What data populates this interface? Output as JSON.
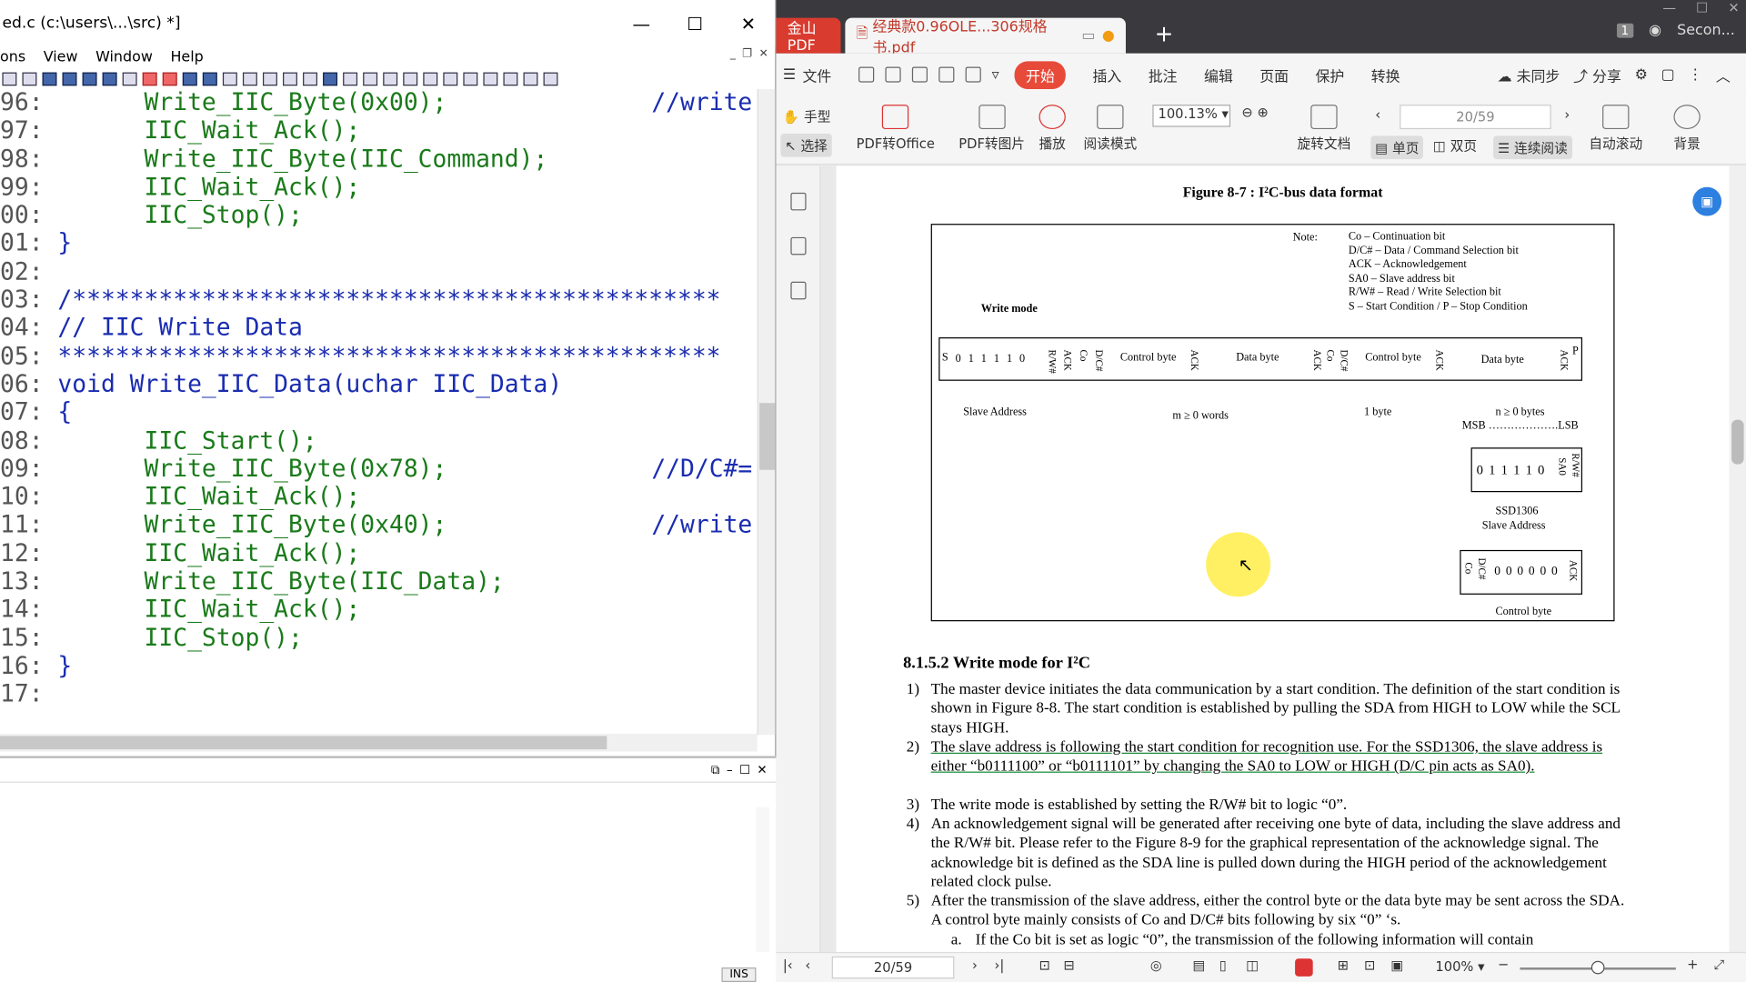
{
  "editor": {
    "title": "ed.c (c:\\users\\...\\src) *]",
    "menu": [
      "ons",
      "View",
      "Window",
      "Help"
    ],
    "code_lines": [
      {
        "num": "96:",
        "text": "      Write_IIC_Byte(0x00);",
        "comment": "//write",
        "cls": "fn"
      },
      {
        "num": "97:",
        "text": "      IIC_Wait_Ack();",
        "comment": "",
        "cls": "fn"
      },
      {
        "num": "98:",
        "text": "      Write_IIC_Byte(IIC_Command);",
        "comment": "",
        "cls": "fn"
      },
      {
        "num": "99:",
        "text": "      IIC_Wait_Ack();",
        "comment": "",
        "cls": "fn"
      },
      {
        "num": "00:",
        "text": "      IIC_Stop();",
        "comment": "",
        "cls": "fn"
      },
      {
        "num": "01:",
        "text": "}",
        "comment": "",
        "cls": "tx"
      },
      {
        "num": "02:",
        "text": "",
        "comment": "",
        "cls": "tx"
      },
      {
        "num": "03:",
        "text": "/*********************************************",
        "comment": "",
        "cls": "cm"
      },
      {
        "num": "04:",
        "text": "// IIC Write Data",
        "comment": "",
        "cls": "cm"
      },
      {
        "num": "05:",
        "text": "**********************************************",
        "comment": "",
        "cls": "cm"
      },
      {
        "num": "06:",
        "text": "void Write_IIC_Data(uchar IIC_Data)",
        "comment": "",
        "cls": "kw"
      },
      {
        "num": "07:",
        "text": "{",
        "comment": "",
        "cls": "tx"
      },
      {
        "num": "08:",
        "text": "      IIC_Start();",
        "comment": "",
        "cls": "fn"
      },
      {
        "num": "09:",
        "text": "      Write_IIC_Byte(0x78);",
        "comment": "//D/C#=",
        "cls": "fn"
      },
      {
        "num": "10:",
        "text": "      IIC_Wait_Ack();",
        "comment": "",
        "cls": "fn"
      },
      {
        "num": "11:",
        "text": "      Write_IIC_Byte(0x40);",
        "comment": "//write",
        "cls": "fn"
      },
      {
        "num": "12:",
        "text": "      IIC_Wait_Ack();",
        "comment": "",
        "cls": "fn"
      },
      {
        "num": "13:",
        "text": "      Write_IIC_Byte(IIC_Data);",
        "comment": "",
        "cls": "fn"
      },
      {
        "num": "14:",
        "text": "      IIC_Wait_Ack();",
        "comment": "",
        "cls": "fn"
      },
      {
        "num": "15:",
        "text": "      IIC_Stop();",
        "comment": "",
        "cls": "fn"
      },
      {
        "num": "16:",
        "text": "}",
        "comment": "",
        "cls": "tx"
      },
      {
        "num": "17:",
        "text": "",
        "comment": "",
        "cls": "tx"
      }
    ],
    "status_ins": "INS"
  },
  "pdf": {
    "tab_app": "金山PDF",
    "tab_doc": "经典款0.96OLE...306规格书.pdf",
    "account": "Secon...",
    "badge": "1",
    "menu": {
      "file": "文件",
      "start": "开始",
      "items": [
        "插入",
        "批注",
        "编辑",
        "页面",
        "保护",
        "转换"
      ],
      "sync": "未同步",
      "share": "分享"
    },
    "ribbon": {
      "hand": "手型",
      "select": "选择",
      "to_office": "PDF转Office",
      "to_image": "PDF转图片",
      "play": "播放",
      "read_mode": "阅读模式",
      "zoom": "100.13%",
      "rotate": "旋转文档",
      "page": "20/59",
      "single": "单页",
      "double": "双页",
      "continuous": "连续阅读",
      "autoscroll": "自动滚动",
      "background": "背景"
    },
    "status": {
      "page": "20/59",
      "zoom": "100%"
    },
    "figure": {
      "title": "Figure 8-7 : I²C-bus data format",
      "note_label": "Note:",
      "notes": [
        "Co – Continuation bit",
        "D/C# – Data / Command Selection bit",
        "ACK – Acknowledgement",
        "SA0 – Slave address bit",
        "R/W# – Read / Write Selection bit",
        "S – Start Condition / P – Stop Condition"
      ],
      "write_mode": "Write mode",
      "s": "S",
      "addr_bits": "0 1 1 1 1 0",
      "rw": "R/W#",
      "ack": "ACK",
      "co": "Co",
      "dc": "D/C#",
      "control_byte": "Control byte",
      "data_byte": "Data byte",
      "p": "P",
      "slave_address": "Slave Address",
      "m_words": "m ≥ 0 words",
      "one_byte": "1 byte",
      "n_bytes": "n ≥ 0 bytes",
      "msb_lsb": "MSB ……………….LSB",
      "ssd_bits": "0 1 1 1 1 0",
      "sa0": "SA0",
      "ssd_label": "SSD1306",
      "ssd_slave": "Slave Address",
      "ctrl_bits": "0 0 0 0 0 0",
      "ctrl_label": "Control byte"
    },
    "section": "8.1.5.2   Write mode for I²C",
    "paras": [
      {
        "n": "1)",
        "text": "The master device initiates the data communication by a start condition. The definition of the start condition is shown in Figure 8-8. The start condition is established by pulling the SDA from HIGH to LOW while the SCL stays HIGH."
      },
      {
        "n": "2)",
        "text": "The slave address is following the start condition for recognition use. For the SSD1306, the slave address is either “b0111100” or “b0111101” by changing the SA0 to LOW or HIGH (D/C pin acts as SA0)."
      },
      {
        "n": "3)",
        "text": "The write mode is established by setting the R/W# bit to logic “0”."
      },
      {
        "n": "4)",
        "text": "An acknowledgement signal will be generated after receiving one byte of data, including the slave address and the R/W# bit. Please refer to the Figure 8-9 for the graphical representation of the acknowledge signal. The acknowledge bit is defined as the SDA line is pulled down during the HIGH period of the acknowledgement related clock pulse."
      },
      {
        "n": "5)",
        "text": "After the transmission of the slave address, either the control byte or the data byte may be sent across the SDA. A control byte mainly consists of Co and D/C# bits following by six “0” ‘s."
      },
      {
        "n": "a.",
        "text": "If the Co bit is set as logic “0”, the transmission of the following information will contain"
      }
    ]
  }
}
